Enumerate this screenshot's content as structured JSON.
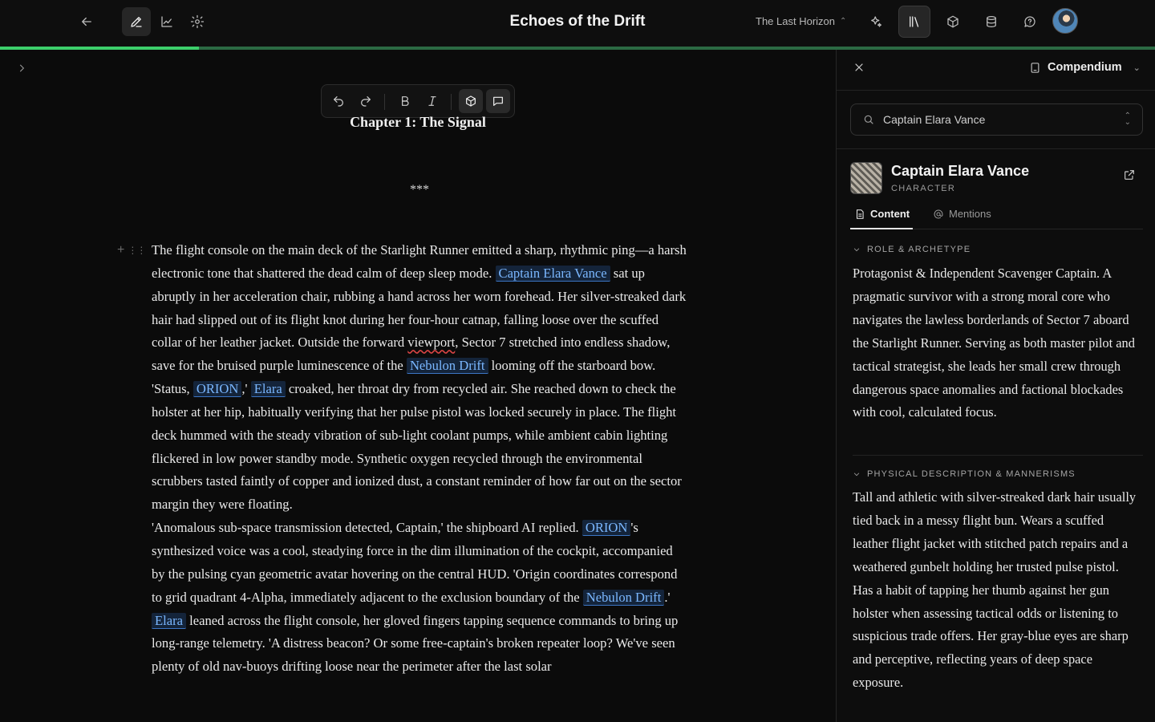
{
  "header": {
    "title": "Echoes of the Drift",
    "project": "The Last Horizon",
    "progress_percent": 17.2
  },
  "editor": {
    "chapter_title": "Chapter 1: The Signal",
    "scene_break": "***"
  },
  "prose": {
    "p1": {
      "t1": "The flight console on the main deck of the Starlight Runner emitted a sharp, rhythmic ping—a harsh electronic tone that shattered the dead calm of deep sleep mode. ",
      "m1": "Captain Elara Vance",
      "t2": " sat up abruptly in her acceleration chair, rubbing a hand across her worn forehead. Her silver-streaked dark hair had slipped out of its flight knot during her four-hour catnap, falling loose over the scuffed collar of her leather jacket. Outside the forward ",
      "w1": "viewport",
      "t3": ", Sector 7 stretched into endless shadow, save for the bruised purple luminescence of the ",
      "m2": "Nebulon Drift",
      "t4": " looming off the starboard bow."
    },
    "p2": {
      "t1": "'Status, ",
      "m1": "ORION",
      "t2": ",' ",
      "m2": "Elara",
      "t3": " croaked, her throat dry from recycled air. She reached down to check the holster at her hip, habitually verifying that her pulse pistol was locked securely in place. The flight deck hummed with the steady vibration of sub-light coolant pumps, while ambient cabin lighting flickered in low power standby mode. Synthetic oxygen recycled through the environmental scrubbers tasted faintly of copper and ionized dust, a constant reminder of how far out on the sector margin they were floating."
    },
    "p3": {
      "t1": "'Anomalous sub-space transmission detected, Captain,' the shipboard AI replied. ",
      "m1": "ORION",
      "t2": "'s synthesized voice was a cool, steadying force in the dim illumination of the cockpit, accompanied by the pulsing cyan geometric avatar hovering on the central HUD. 'Origin coordinates correspond to grid quadrant 4-Alpha, immediately adjacent to the exclusion boundary of the ",
      "m2": "Nebulon Drift",
      "t3": ".'"
    },
    "p4": {
      "m1": "Elara",
      "t1": " leaned across the flight console, her gloved fingers tapping sequence commands to bring up long-range telemetry. 'A distress beacon? Or some free-captain's broken repeater loop? We've seen plenty of old nav-buoys drifting loose near the perimeter after the last solar"
    }
  },
  "panel": {
    "title": "Compendium",
    "search_value": "Captain Elara Vance",
    "entity_name": "Captain Elara Vance",
    "entity_type": "CHARACTER",
    "tabs": {
      "content": "Content",
      "mentions": "Mentions"
    },
    "sections": [
      {
        "heading": "ROLE & ARCHETYPE",
        "body": "Protagonist & Independent Scavenger Captain. A pragmatic survivor with a strong moral core who navigates the lawless borderlands of Sector 7 aboard the Starlight Runner. Serving as both master pilot and tactical strategist, she leads her small crew through dangerous space anomalies and factional blockades with cool, calculated focus."
      },
      {
        "heading": "PHYSICAL DESCRIPTION & MANNERISMS",
        "body": "Tall and athletic with silver-streaked dark hair usually tied back in a messy flight bun. Wears a scuffed leather flight jacket with stitched patch repairs and a weathered gunbelt holding her trusted pulse pistol. Has a habit of tapping her thumb against her gun holster when assessing tactical odds or listening to suspicious trade offers. Her gray-blue eyes are sharp and perceptive, reflecting years of deep space exposure."
      }
    ]
  },
  "colors": {
    "accent": "#3ccf6b",
    "mention_bg": "#14243a",
    "mention_text": "#7ab7ff",
    "background": "#0b0b0b"
  }
}
